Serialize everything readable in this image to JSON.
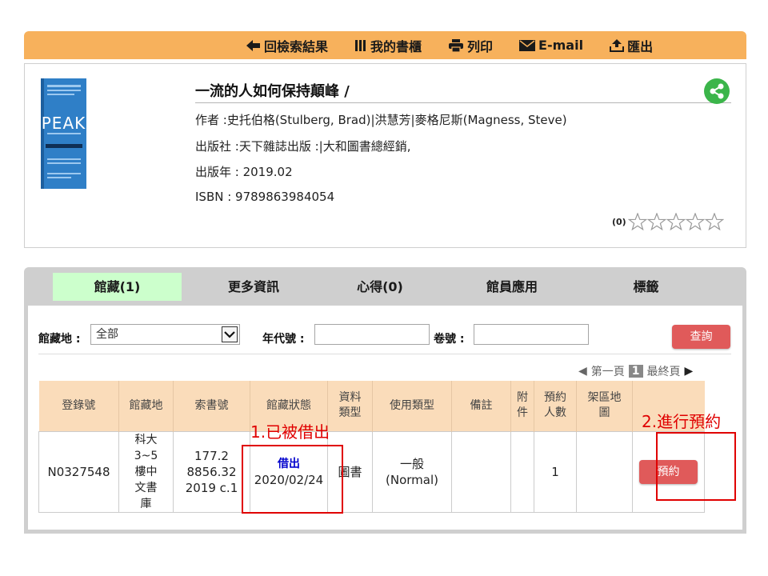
{
  "toolbar": {
    "items": [
      {
        "label": "回檢索結果",
        "icon": "arrow-left-icon"
      },
      {
        "label": "我的書櫃",
        "icon": "bookshelf-icon"
      },
      {
        "label": "列印",
        "icon": "printer-icon"
      },
      {
        "label": "E-mail",
        "icon": "envelope-icon"
      },
      {
        "label": "匯出",
        "icon": "export-icon"
      }
    ]
  },
  "record": {
    "title": "一流的人如何保持顛峰 /",
    "author": "作者 :史托伯格(Stulberg, Brad)|洪慧芳|麥格尼斯(Magness, Steve)",
    "publisher": "出版社 :天下雜誌出版 :|大和圖書總經銷,",
    "year": "出版年 : 2019.02",
    "isbn": "ISBN : 9789863984054",
    "rating_count": "(0)",
    "stars": 0,
    "cover": {
      "brand": "PEAK",
      "subtitle": "一流的人如何保持顛峰",
      "color": "#2f7fc7"
    }
  },
  "tabs": [
    {
      "label": "館藏(1)",
      "active": true
    },
    {
      "label": "更多資訊",
      "active": false
    },
    {
      "label": "心得(0)",
      "active": false
    },
    {
      "label": "館員應用",
      "active": false
    },
    {
      "label": "標籤",
      "active": false
    }
  ],
  "filters": {
    "location_label": "館藏地 :",
    "location_value": "全部",
    "year_label": "年代號 :",
    "volume_label": "卷號 :",
    "query_button": "查詢"
  },
  "pager": {
    "first": "第一頁",
    "current": "1",
    "last": "最終頁"
  },
  "table": {
    "headers": [
      "登錄號",
      "館藏地",
      "索書號",
      "館藏狀態",
      "資料類型",
      "使用類型",
      "備註",
      "附件",
      "預約人數",
      "架區地圖",
      ""
    ],
    "row": {
      "accession": "N0327548",
      "location": "科大3~5樓中文書庫",
      "call_number": "177.2 8856.32 2019 c.1",
      "status": "借出",
      "due_date": "2020/02/24",
      "material_type": "圖書",
      "usage_type": "一般(Normal)",
      "note": "",
      "attachment": "",
      "reservations": "1",
      "shelf_map": "",
      "reserve_button": "預約"
    }
  },
  "annotations": {
    "borrowed": "1.已被借出",
    "reserve": "2.進行預約"
  },
  "colors": {
    "toolbar": "#f7b15c",
    "accent_red": "#e05a5a",
    "annotation_red": "#e00000",
    "active_tab": "#ccffcc",
    "table_header": "#fadcba",
    "share": "#3bb54a"
  }
}
